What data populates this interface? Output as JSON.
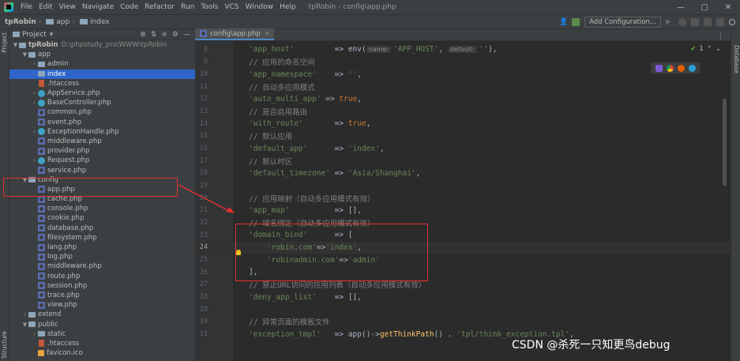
{
  "menubar": {
    "menus": [
      "File",
      "Edit",
      "View",
      "Navigate",
      "Code",
      "Refactor",
      "Run",
      "Tools",
      "VCS",
      "Window",
      "Help"
    ],
    "window_title": "tpRobin - config\\app.php",
    "controls": [
      "—",
      "▢",
      "✕"
    ]
  },
  "navbar": {
    "crumbs": [
      "tpRobin",
      "app",
      "index"
    ],
    "config_label": "Add Configuration..."
  },
  "left_strip": {
    "project": "Project",
    "structure": "Structure"
  },
  "right_strip": {
    "database": "Database"
  },
  "project_panel": {
    "title": "Project",
    "root_name": "tpRobin",
    "root_path": "D:\\phpstudy_pro\\WWW\\tpRobin",
    "tree": [
      {
        "label": "app",
        "icon": "folder-icon",
        "arrow": "▼",
        "depth": 1
      },
      {
        "label": "admin",
        "icon": "folder-icon",
        "arrow": "›",
        "depth": 2
      },
      {
        "label": "index",
        "icon": "folder-icon",
        "arrow": "›",
        "depth": 2,
        "selected": true
      },
      {
        "label": ".htaccess",
        "icon": "htaccess-icon",
        "arrow": "",
        "depth": 2
      },
      {
        "label": "AppService.php",
        "icon": "class-icon",
        "arrow": "›",
        "depth": 2
      },
      {
        "label": "BaseController.php",
        "icon": "class-icon",
        "arrow": "›",
        "depth": 2
      },
      {
        "label": "common.php",
        "icon": "php-icon",
        "arrow": "",
        "depth": 2
      },
      {
        "label": "event.php",
        "icon": "php-icon",
        "arrow": "",
        "depth": 2
      },
      {
        "label": "ExceptionHandle.php",
        "icon": "class-icon",
        "arrow": "›",
        "depth": 2
      },
      {
        "label": "middleware.php",
        "icon": "php-icon",
        "arrow": "",
        "depth": 2
      },
      {
        "label": "provider.php",
        "icon": "php-icon",
        "arrow": "",
        "depth": 2
      },
      {
        "label": "Request.php",
        "icon": "class-icon",
        "arrow": "›",
        "depth": 2
      },
      {
        "label": "service.php",
        "icon": "php-icon",
        "arrow": "",
        "depth": 2
      },
      {
        "label": "config",
        "icon": "folder-icon",
        "arrow": "▼",
        "depth": 1
      },
      {
        "label": "app.php",
        "icon": "php-icon",
        "arrow": "",
        "depth": 2
      },
      {
        "label": "cache.php",
        "icon": "php-icon",
        "arrow": "",
        "depth": 2
      },
      {
        "label": "console.php",
        "icon": "php-icon",
        "arrow": "",
        "depth": 2
      },
      {
        "label": "cookie.php",
        "icon": "php-icon",
        "arrow": "",
        "depth": 2
      },
      {
        "label": "database.php",
        "icon": "php-icon",
        "arrow": "",
        "depth": 2
      },
      {
        "label": "filesystem.php",
        "icon": "php-icon",
        "arrow": "",
        "depth": 2
      },
      {
        "label": "lang.php",
        "icon": "php-icon",
        "arrow": "",
        "depth": 2
      },
      {
        "label": "log.php",
        "icon": "php-icon",
        "arrow": "",
        "depth": 2
      },
      {
        "label": "middleware.php",
        "icon": "php-icon",
        "arrow": "",
        "depth": 2
      },
      {
        "label": "route.php",
        "icon": "php-icon",
        "arrow": "",
        "depth": 2
      },
      {
        "label": "session.php",
        "icon": "php-icon",
        "arrow": "",
        "depth": 2
      },
      {
        "label": "trace.php",
        "icon": "php-icon",
        "arrow": "",
        "depth": 2
      },
      {
        "label": "view.php",
        "icon": "php-icon",
        "arrow": "",
        "depth": 2
      },
      {
        "label": "extend",
        "icon": "folder-icon",
        "arrow": "›",
        "depth": 1
      },
      {
        "label": "public",
        "icon": "folder-icon",
        "arrow": "▼",
        "depth": 1
      },
      {
        "label": "static",
        "icon": "folder-icon",
        "arrow": "›",
        "depth": 2
      },
      {
        "label": ".htaccess",
        "icon": "htaccess-icon",
        "arrow": "",
        "depth": 2
      },
      {
        "label": "favicon.ico",
        "icon": "ico-icon",
        "arrow": "",
        "depth": 2
      }
    ]
  },
  "editor": {
    "tab_label": "config\\app.php",
    "inspection": "1",
    "current_line": 24,
    "lines": [
      {
        "n": 8,
        "tokens": [
          [
            "s",
            "'app_host'"
          ],
          [
            "t",
            "         => env("
          ],
          [
            "h",
            "name:"
          ],
          [
            "s",
            "'APP_HOST'"
          ],
          [
            "t",
            ", "
          ],
          [
            "h",
            "default:"
          ],
          [
            "s",
            "''"
          ],
          [
            "t",
            "),"
          ]
        ]
      },
      {
        "n": 9,
        "tokens": [
          [
            "c",
            "// 应用的命名空间"
          ]
        ]
      },
      {
        "n": 10,
        "tokens": [
          [
            "s",
            "'app_namespace'"
          ],
          [
            "t",
            "    => "
          ],
          [
            "s",
            "''"
          ],
          [
            "t",
            ","
          ]
        ]
      },
      {
        "n": 11,
        "tokens": [
          [
            "c",
            "// 自动多应用模式"
          ]
        ]
      },
      {
        "n": 12,
        "tokens": [
          [
            "s",
            "'auto_multi_app'"
          ],
          [
            "t",
            " => "
          ],
          [
            "k",
            "true"
          ],
          [
            "t",
            ","
          ]
        ]
      },
      {
        "n": 13,
        "tokens": [
          [
            "c",
            "// 是否启用路由"
          ]
        ]
      },
      {
        "n": 14,
        "tokens": [
          [
            "s",
            "'with_route'"
          ],
          [
            "t",
            "       => "
          ],
          [
            "k",
            "true"
          ],
          [
            "t",
            ","
          ]
        ]
      },
      {
        "n": 15,
        "tokens": [
          [
            "c",
            "// 默认应用"
          ]
        ]
      },
      {
        "n": 16,
        "tokens": [
          [
            "s",
            "'default_app'"
          ],
          [
            "t",
            "      => "
          ],
          [
            "s",
            "'index'"
          ],
          [
            "t",
            ","
          ]
        ]
      },
      {
        "n": 17,
        "tokens": [
          [
            "c",
            "// 默认时区"
          ]
        ]
      },
      {
        "n": 18,
        "tokens": [
          [
            "s",
            "'default_timezone'"
          ],
          [
            "t",
            " => "
          ],
          [
            "s",
            "'Asia/Shanghai'"
          ],
          [
            "t",
            ","
          ]
        ]
      },
      {
        "n": 19,
        "tokens": []
      },
      {
        "n": 20,
        "tokens": [
          [
            "c",
            "// 应用映射（自动多应用模式有效）"
          ]
        ]
      },
      {
        "n": 21,
        "tokens": [
          [
            "s",
            "'app_map'"
          ],
          [
            "t",
            "          => [],"
          ]
        ]
      },
      {
        "n": 22,
        "tokens": [
          [
            "c",
            "// 域名绑定（自动多应用模式有效）"
          ]
        ]
      },
      {
        "n": 23,
        "tokens": [
          [
            "s",
            "'domain_bind'"
          ],
          [
            "t",
            "      => ["
          ]
        ]
      },
      {
        "n": 24,
        "tokens": [
          [
            "t",
            "    "
          ],
          [
            "s",
            "'robin.com'"
          ],
          [
            "t",
            "=>"
          ],
          [
            "s",
            "'index'"
          ],
          [
            "t",
            ","
          ]
        ]
      },
      {
        "n": 25,
        "tokens": [
          [
            "t",
            "    "
          ],
          [
            "s",
            "'robinadmin.com'"
          ],
          [
            "t",
            "=>"
          ],
          [
            "s",
            "'admin'"
          ]
        ]
      },
      {
        "n": 26,
        "tokens": [
          [
            "t",
            "],"
          ]
        ]
      },
      {
        "n": 27,
        "tokens": [
          [
            "c",
            "// 禁止URL访问的应用列表（自动多应用模式有效）"
          ]
        ]
      },
      {
        "n": 28,
        "tokens": [
          [
            "s",
            "'deny_app_list'"
          ],
          [
            "t",
            "    => [],"
          ]
        ]
      },
      {
        "n": 29,
        "tokens": []
      },
      {
        "n": 30,
        "tokens": [
          [
            "c",
            "// 异常页面的模板文件"
          ]
        ]
      },
      {
        "n": 31,
        "tokens": [
          [
            "s",
            "'exception_tmpl'"
          ],
          [
            "t",
            "   => app()->"
          ],
          [
            "f",
            "getThinkPath"
          ],
          [
            "t",
            "() . "
          ],
          [
            "s",
            "'tpl/think_exception.tpl'"
          ],
          [
            "t",
            ","
          ]
        ]
      }
    ]
  },
  "watermark": "CSDN @杀死一只知更鸟debug",
  "colors": {
    "annotation": "#e03030",
    "selection": "#2f65ca"
  }
}
